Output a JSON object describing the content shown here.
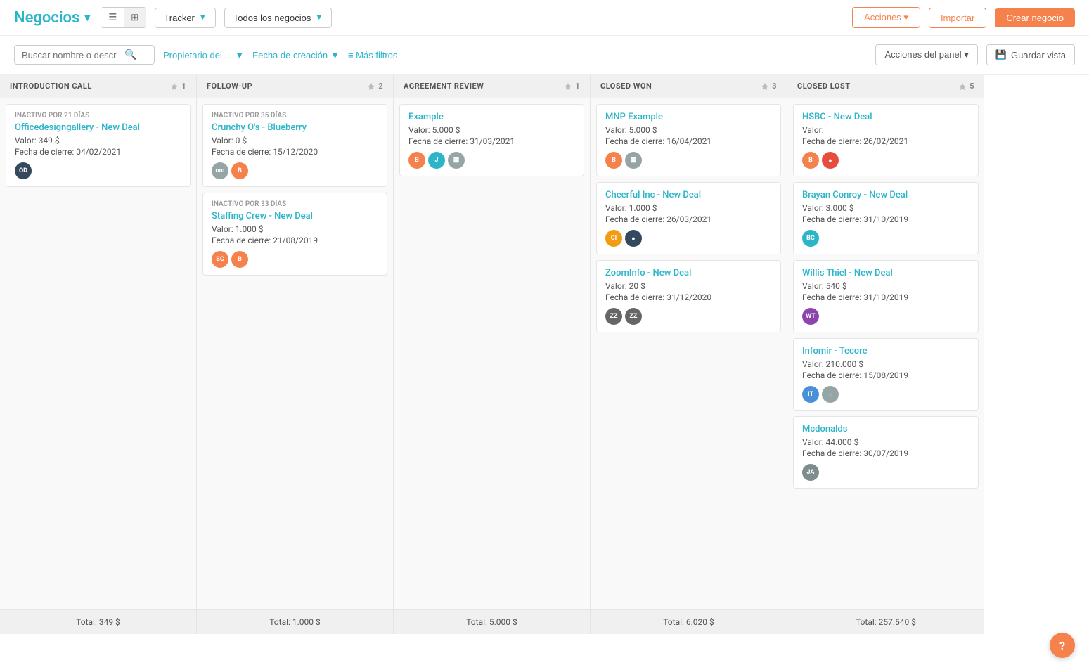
{
  "app": {
    "title": "Negocios",
    "chevron": "▼"
  },
  "views": {
    "list_icon": "☰",
    "grid_icon": "⊞"
  },
  "trackerDropdown": {
    "label": "Tracker",
    "chevron": "▼"
  },
  "businessDropdown": {
    "label": "Todos los negocios",
    "chevron": "▼"
  },
  "topButtons": {
    "acciones": "Acciones ▾",
    "importar": "Importar",
    "crear": "Crear negocio"
  },
  "filterBar": {
    "searchPlaceholder": "Buscar nombre o descr",
    "searchIcon": "🔍",
    "propietario": "Propietario del ...",
    "fecha": "Fecha de creación",
    "masFilters": "≡ Más filtros",
    "accionesPanel": "Acciones del panel ▾",
    "guardarVista": "Guardar vista"
  },
  "columns": [
    {
      "id": "introduction_call",
      "title": "INTRODUCTION CALL",
      "count": 1,
      "countIcon": "⚡",
      "cards": [
        {
          "inactive": "INACTIVO POR 21 DÍAS",
          "name": "Officedesigngallery - New Deal",
          "value": "Valor: 349 $",
          "date": "Fecha de cierre: 04/02/2021",
          "avatars": [
            {
              "initials": "OD",
              "color": "av-dark",
              "img": true
            }
          ]
        }
      ],
      "total": "Total: 349 $"
    },
    {
      "id": "follow_up",
      "title": "FOLLOW-UP",
      "count": 2,
      "countIcon": "⚡",
      "cards": [
        {
          "inactive": "INACTIVO POR 35 DÍAS",
          "name": "Crunchy O's - Blueberry",
          "value": "Valor: 0 $",
          "date": "Fecha de cierre: 15/12/2020",
          "avatars": [
            {
              "initials": "om",
              "color": "av-gray"
            },
            {
              "initials": "B",
              "color": "av-orange"
            }
          ]
        },
        {
          "inactive": "INACTIVO POR 33 DÍAS",
          "name": "Staffing Crew - New Deal",
          "value": "Valor: 1.000 $",
          "date": "Fecha de cierre: 21/08/2019",
          "avatars": [
            {
              "initials": "SC",
              "color": "av-orange"
            },
            {
              "initials": "B",
              "color": "av-orange"
            }
          ]
        }
      ],
      "total": "Total: 1.000 $"
    },
    {
      "id": "agreement_review",
      "title": "AGREEMENT REVIEW",
      "count": 1,
      "countIcon": "⚡",
      "cards": [
        {
          "inactive": "",
          "name": "Example",
          "value": "Valor: 5.000 $",
          "date": "Fecha de cierre: 31/03/2021",
          "avatars": [
            {
              "initials": "B",
              "color": "av-orange"
            },
            {
              "initials": "J",
              "color": "av-teal"
            },
            {
              "initials": "▦",
              "color": "av-gray"
            }
          ]
        }
      ],
      "total": "Total: 5.000 $"
    },
    {
      "id": "closed_won",
      "title": "CLOSED WON",
      "count": 3,
      "countIcon": "⚡",
      "cards": [
        {
          "inactive": "",
          "name": "MNP Example",
          "value": "Valor: 5.000 $",
          "date": "Fecha de cierre: 16/04/2021",
          "avatars": [
            {
              "initials": "B",
              "color": "av-orange"
            },
            {
              "initials": "▦",
              "color": "av-gray"
            }
          ]
        },
        {
          "inactive": "",
          "name": "Cheerful Inc - New Deal",
          "value": "Valor: 1.000 $",
          "date": "Fecha de cierre: 26/03/2021",
          "avatars": [
            {
              "initials": "CI",
              "color": "av-yellow"
            },
            {
              "initials": "●",
              "color": "av-dark"
            }
          ]
        },
        {
          "inactive": "",
          "name": "ZoomInfo - New Deal",
          "value": "Valor: 20 $",
          "date": "Fecha de cierre: 31/12/2020",
          "avatars": [
            {
              "initials": "ZZ",
              "color": "av-zz"
            },
            {
              "initials": "ZZ",
              "color": "av-zz"
            }
          ]
        }
      ],
      "total": "Total: 6.020 $"
    },
    {
      "id": "closed_lost",
      "title": "CLOSED LOST",
      "count": 5,
      "countIcon": "⚡",
      "cards": [
        {
          "inactive": "",
          "name": "HSBC - New Deal",
          "value": "Valor:",
          "date": "Fecha de cierre: 26/02/2021",
          "avatars": [
            {
              "initials": "B",
              "color": "av-orange"
            },
            {
              "initials": "●",
              "color": "av-red"
            }
          ]
        },
        {
          "inactive": "",
          "name": "Brayan Conroy - New Deal",
          "value": "Valor: 3.000 $",
          "date": "Fecha de cierre: 31/10/2019",
          "avatars": [
            {
              "initials": "BC",
              "color": "av-bc"
            }
          ]
        },
        {
          "inactive": "",
          "name": "Willis Thiel - New Deal",
          "value": "Valor: 540 $",
          "date": "Fecha de cierre: 31/10/2019",
          "avatars": [
            {
              "initials": "WT",
              "color": "av-wt"
            }
          ]
        },
        {
          "inactive": "",
          "name": "Infomir - Tecore",
          "value": "Valor: 210.000 $",
          "date": "Fecha de cierre: 15/08/2019",
          "avatars": [
            {
              "initials": "IT",
              "color": "av-blue"
            },
            {
              "initials": "◌",
              "color": "av-gray"
            }
          ]
        },
        {
          "inactive": "",
          "name": "Mcdonalds",
          "value": "Valor: 44.000 $",
          "date": "Fecha de cierre: 30/07/2019",
          "avatars": [
            {
              "initials": "JA",
              "color": "av-ja"
            }
          ]
        }
      ],
      "total": "Total: 257.540 $"
    }
  ]
}
